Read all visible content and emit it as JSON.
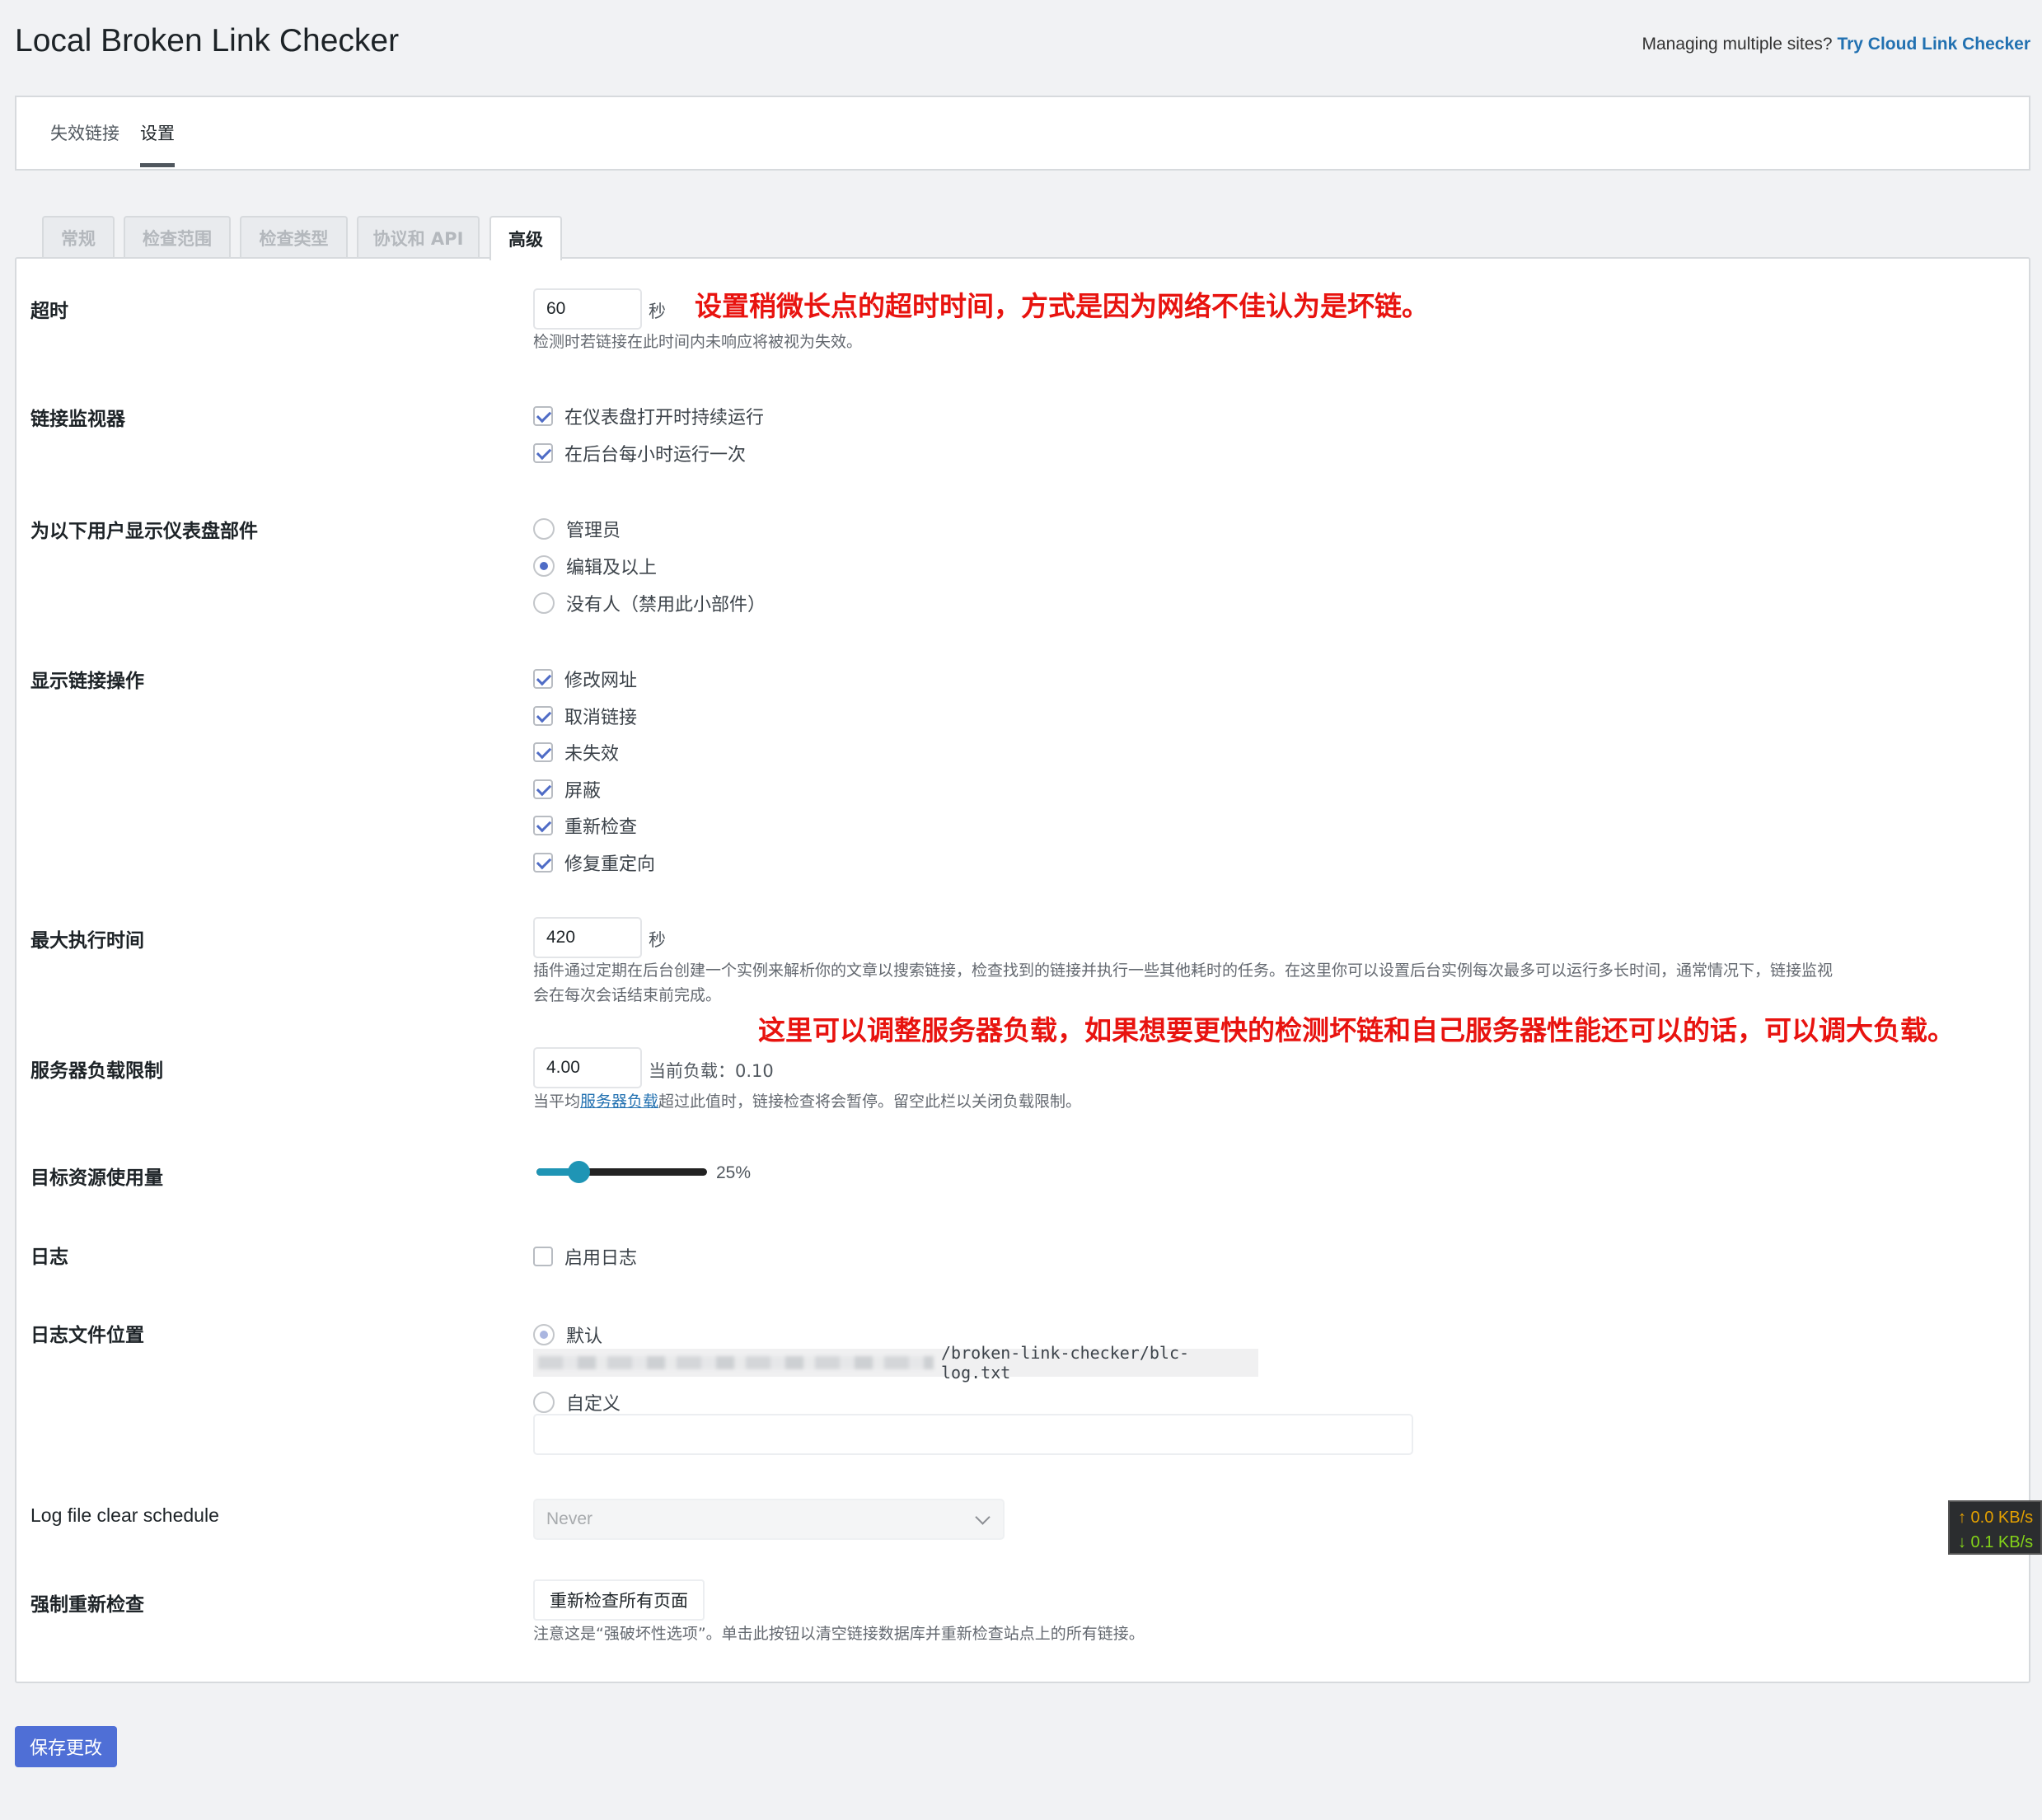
{
  "header": {
    "title": "Local Broken Link Checker",
    "promo_text": "Managing multiple sites?",
    "promo_link": "Try Cloud Link Checker"
  },
  "main_tabs": [
    {
      "label": "失效链接",
      "active": false
    },
    {
      "label": "设置",
      "active": true
    }
  ],
  "sub_tabs": [
    {
      "label": "常规",
      "active": false
    },
    {
      "label": "检查范围",
      "active": false
    },
    {
      "label": "检查类型",
      "active": false
    },
    {
      "label": "协议和 API",
      "active": false
    },
    {
      "label": "高级",
      "active": true
    }
  ],
  "settings": {
    "timeout": {
      "label": "超时",
      "value": "60",
      "unit": "秒",
      "desc": "检测时若链接在此时间内未响应将被视为失效。"
    },
    "link_monitor": {
      "label": "链接监视器",
      "options": [
        {
          "label": "在仪表盘打开时持续运行",
          "checked": true
        },
        {
          "label": "在后台每小时运行一次",
          "checked": true
        }
      ]
    },
    "dashboard_widget": {
      "label": "为以下用户显示仪表盘部件",
      "options": [
        {
          "label": "管理员",
          "checked": false
        },
        {
          "label": "编辑及以上",
          "checked": true
        },
        {
          "label": "没有人（禁用此小部件）",
          "checked": false
        }
      ]
    },
    "link_actions": {
      "label": "显示链接操作",
      "options": [
        {
          "label": "修改网址",
          "checked": true
        },
        {
          "label": "取消链接",
          "checked": true
        },
        {
          "label": "未失效",
          "checked": true
        },
        {
          "label": "屏蔽",
          "checked": true
        },
        {
          "label": "重新检查",
          "checked": true
        },
        {
          "label": "修复重定向",
          "checked": true
        }
      ]
    },
    "max_exec_time": {
      "label": "最大执行时间",
      "value": "420",
      "unit": "秒",
      "desc_line1": "插件通过定期在后台创建一个实例来解析你的文章以搜索链接，检查找到的链接并执行一些其他耗时的任务。在这里你可以设置后台实例每次最多可以运行多长时间，通常情况下，链接监视",
      "desc_line2": "会在每次会话结束前完成。"
    },
    "server_load": {
      "label": "服务器负载限制",
      "value": "4.00",
      "current_label": "当前负载：",
      "current_value": "0.10",
      "desc_before": "当平均",
      "desc_link": "服务器负载",
      "desc_after": "超过此值时，链接检查将会暂停。留空此栏以关闭负载限制。"
    },
    "target_resource": {
      "label": "目标资源使用量",
      "value_percent": 25,
      "value_text": "25%"
    },
    "logging": {
      "label": "日志",
      "option": {
        "label": "启用日志",
        "checked": false
      }
    },
    "log_location": {
      "label": "日志文件位置",
      "default_label": "默认",
      "default_checked": true,
      "default_path_suffix": "/broken-link-checker/blc-log.txt",
      "custom_label": "自定义",
      "custom_checked": false,
      "custom_value": ""
    },
    "log_clear": {
      "label": "Log file clear schedule",
      "selected": "Never"
    },
    "force_recheck": {
      "label": "强制重新检查",
      "button": "重新检查所有页面",
      "desc": "注意这是“强破坏性选项”。单击此按钮以清空链接数据库并重新检查站点上的所有链接。"
    }
  },
  "annotations": {
    "timeout_note": "设置稍微长点的超时时间，方式是因为网络不佳认为是坏链。",
    "load_note": "这里可以调整服务器负载，如果想要更快的检测坏链和自己服务器性能还可以的话，可以调大负载。"
  },
  "save_button": "保存更改",
  "net_monitor": {
    "up": "↑ 0.0 KB/s",
    "down": "↓ 0.1 KB/s"
  },
  "colors": {
    "accent": "#4f6fd6",
    "annotation": "#e8130f",
    "slider": "#1f95b5",
    "link": "#2271b1"
  }
}
